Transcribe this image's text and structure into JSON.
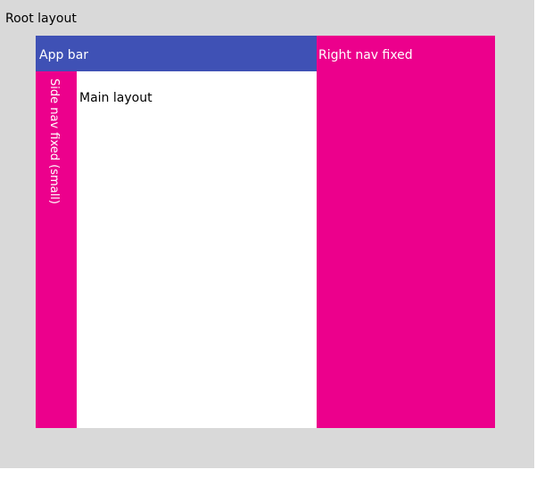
{
  "root": {
    "label": "Root layout"
  },
  "app_bar": {
    "label": "App bar"
  },
  "side_nav": {
    "label": "Side nav fixed (small)"
  },
  "main": {
    "label": "Main layout"
  },
  "right_nav": {
    "label": "Right nav fixed"
  },
  "colors": {
    "root_bg": "#d9d9d9",
    "app_bar": "#3f51b5",
    "nav": "#ec008c",
    "main_bg": "#ffffff"
  }
}
